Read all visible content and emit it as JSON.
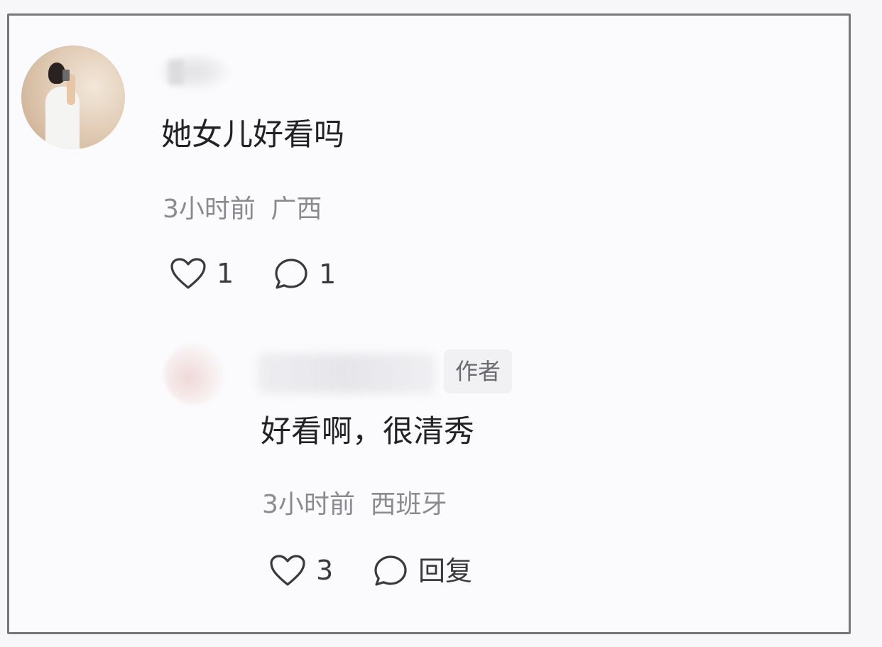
{
  "comment": {
    "text": "她女儿好看吗",
    "time": "3小时前",
    "location": "广西",
    "likes": "1",
    "replies": "1",
    "avatar_icon": "user-avatar-photo"
  },
  "reply": {
    "badge": "作者",
    "text": "好看啊，很清秀",
    "time": "3小时前",
    "location": "西班牙",
    "likes": "3",
    "reply_label": "回复",
    "avatar_icon": "author-avatar"
  },
  "icons": {
    "like": "heart-outline-icon",
    "comment": "speech-bubble-outline-icon"
  },
  "colors": {
    "text": "#222226",
    "meta": "#8a8a90",
    "icon": "#3a3a3e",
    "border": "#77777b",
    "badge_bg": "#f1f1f3"
  }
}
